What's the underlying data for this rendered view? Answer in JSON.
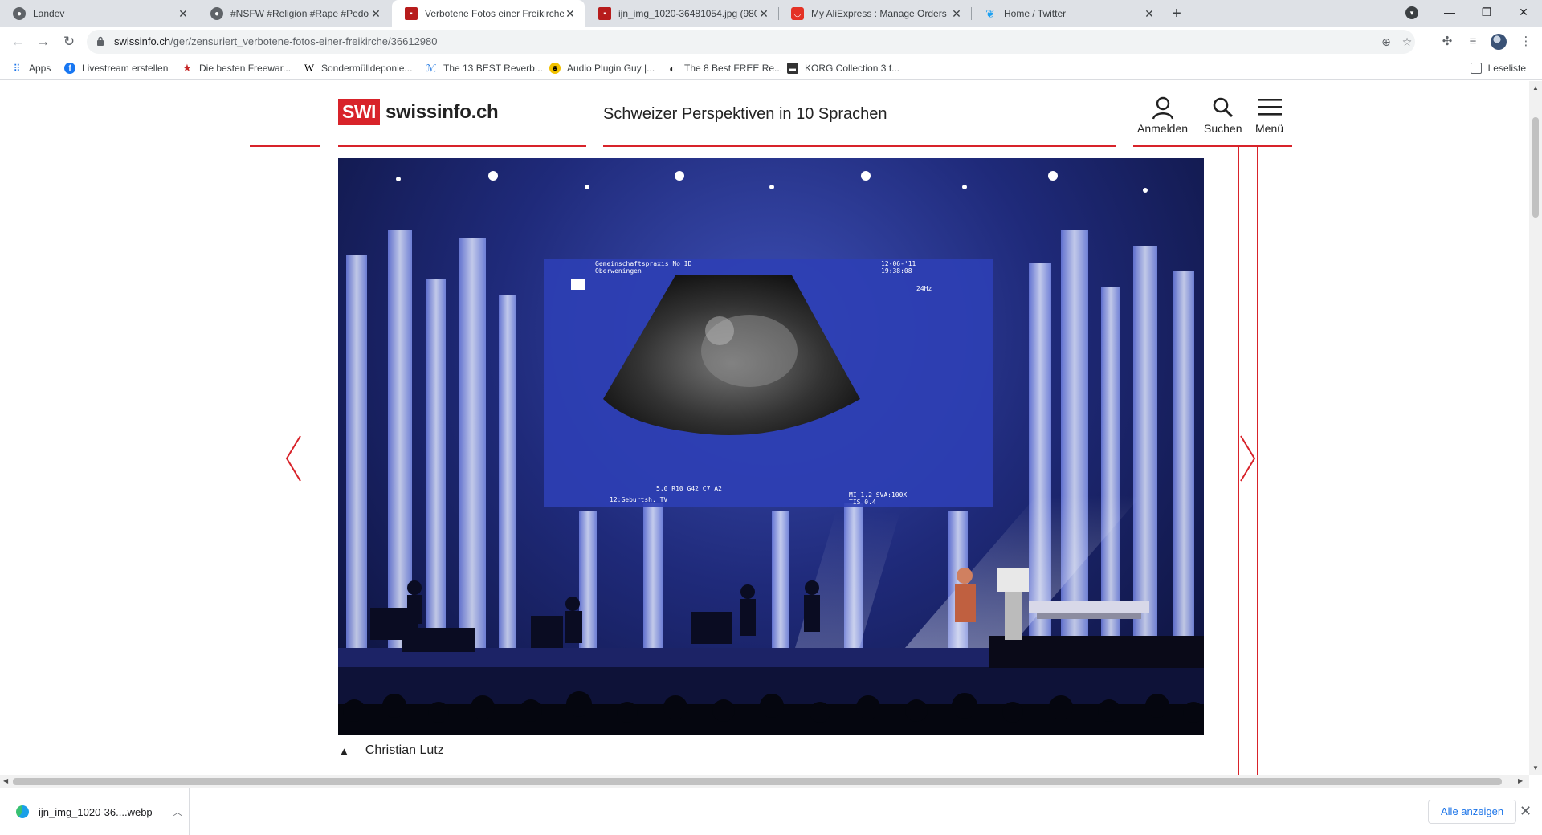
{
  "browser": {
    "tabs": [
      {
        "title": "Landev",
        "icon": "generic-globe-icon",
        "active": false
      },
      {
        "title": "#NSFW #Religion #Rape #Pedo #",
        "icon": "generic-globe-icon",
        "active": false
      },
      {
        "title": "Verbotene Fotos einer Freikirche",
        "icon": "swi-favicon-icon",
        "active": true
      },
      {
        "title": "ijn_img_1020-36481054.jpg (980",
        "icon": "swi-favicon-icon",
        "active": false
      },
      {
        "title": "My AliExpress : Manage Orders",
        "icon": "aliexpress-icon",
        "active": false
      },
      {
        "title": "Home / Twitter",
        "icon": "twitter-icon",
        "active": false
      }
    ],
    "url_host": "swissinfo.ch",
    "url_path": "/ger/zensuriert_verbotene-fotos-einer-freikirche/36612980",
    "bookmarks": [
      {
        "label": "Apps",
        "icon": "apps-grid-icon"
      },
      {
        "label": "Livestream erstellen",
        "icon": "facebook-icon"
      },
      {
        "label": "Die besten Freewar...",
        "icon": "star-red-icon"
      },
      {
        "label": "Sondermülldeponie...",
        "icon": "wikipedia-icon"
      },
      {
        "label": "The 13 BEST Reverb...",
        "icon": "music-icon"
      },
      {
        "label": "Audio Plugin Guy |...",
        "icon": "plugin-guy-icon"
      },
      {
        "label": "The 8 Best FREE Re...",
        "icon": "moon-icon"
      },
      {
        "label": "KORG Collection 3 f...",
        "icon": "korg-icon"
      }
    ],
    "reading_list": "Leseliste"
  },
  "site": {
    "logo_badge": "SWI",
    "logo_name": "swissinfo.ch",
    "tagline": "Schweizer Perspektiven in 10 Sprachen",
    "login_label": "Anmelden",
    "search_label": "Suchen",
    "menu_label": "Menü",
    "accent_color": "#d8232a"
  },
  "gallery": {
    "caption": "Christian Lutz",
    "screen_text": {
      "top_left": "Gemeinschaftspraxis  No ID",
      "top_left_2": "Oberweningen",
      "top_right": "12-06-'11",
      "top_right_2": "19:38:08",
      "hz": "24Hz",
      "bottom_params": "5.0 R10 G42 C7  A2",
      "bottom_left": "12:Geburtsh. TV",
      "bottom_right": "MI 1.2  SVA:100X",
      "bottom_right_2": "TIS 0.4"
    }
  },
  "download": {
    "filename": "ijn_img_1020-36....webp",
    "show_all": "Alle anzeigen"
  }
}
